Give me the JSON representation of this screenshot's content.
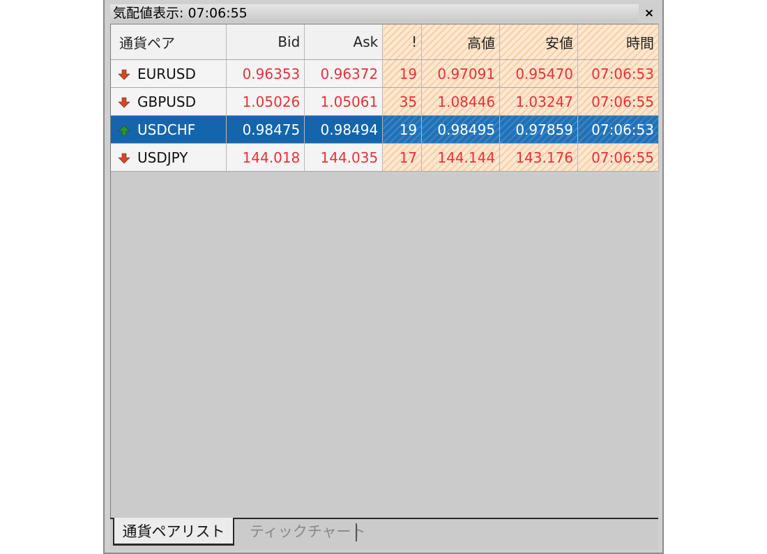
{
  "window": {
    "title": "気配値表示: 07:06:55",
    "close_label": "×"
  },
  "table": {
    "columns": [
      "通貨ペア",
      "Bid",
      "Ask",
      "!",
      "高値",
      "安値",
      "時間"
    ],
    "rows": [
      {
        "symbol": "EURUSD",
        "direction": "down",
        "bid": "0.96353",
        "ask": "0.96372",
        "spread": "19",
        "high": "0.97091",
        "low": "0.95470",
        "time": "07:06:53"
      },
      {
        "symbol": "GBPUSD",
        "direction": "down",
        "bid": "1.05026",
        "ask": "1.05061",
        "spread": "35",
        "high": "1.08446",
        "low": "1.03247",
        "time": "07:06:55"
      },
      {
        "symbol": "USDCHF",
        "direction": "up",
        "bid": "0.98475",
        "ask": "0.98494",
        "spread": "19",
        "high": "0.98495",
        "low": "0.97859",
        "time": "07:06:53",
        "selected": true
      },
      {
        "symbol": "USDJPY",
        "direction": "down",
        "bid": "144.018",
        "ask": "144.035",
        "spread": "17",
        "high": "144.144",
        "low": "143.176",
        "time": "07:06:55"
      }
    ]
  },
  "tabs": [
    {
      "label": "通貨ペアリスト",
      "active": true
    },
    {
      "label": "ティックチャート",
      "active": false
    }
  ],
  "colors": {
    "price_text": "#e8303a",
    "selected_row": "#1565ac",
    "down_arrow": "#d9461f",
    "up_arrow": "#1f9a2c"
  },
  "icons": {
    "down": "down-arrow-icon",
    "up": "up-arrow-icon"
  }
}
